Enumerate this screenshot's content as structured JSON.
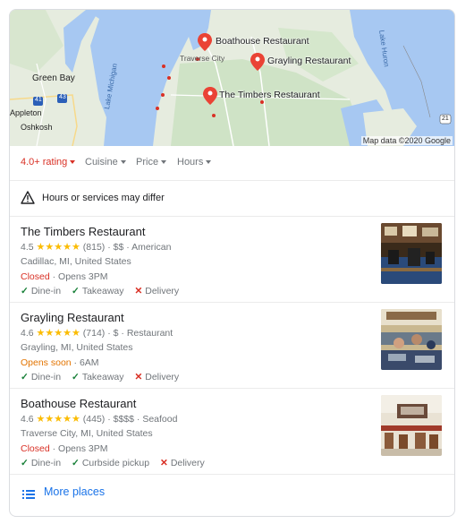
{
  "map": {
    "pins": [
      {
        "label": "Boathouse Restaurant"
      },
      {
        "label": "Grayling Restaurant"
      },
      {
        "label": "The Timbers Restaurant"
      }
    ],
    "place_labels": [
      "Green Bay",
      "Appleton",
      "Oshkosh",
      "Traverse City",
      "Lake Michigan",
      "Lake Huron"
    ],
    "road_labels": [
      "41",
      "43",
      "21"
    ],
    "credit": "Map data ©2020 Google"
  },
  "filters": [
    {
      "label": "4.0+ rating",
      "active": true
    },
    {
      "label": "Cuisine",
      "active": false
    },
    {
      "label": "Price",
      "active": false
    },
    {
      "label": "Hours",
      "active": false
    }
  ],
  "notice": "Hours or services may differ",
  "results": [
    {
      "title": "The Timbers Restaurant",
      "rating": "4.5",
      "stars": "★★★★★",
      "reviews": "(815)",
      "price": "$$",
      "category": "American",
      "address": "Cadillac, MI, United States",
      "status": "Closed",
      "status_color": "#d93025",
      "status_detail": "Opens 3PM",
      "services": [
        {
          "label": "Dine-in",
          "available": true
        },
        {
          "label": "Takeaway",
          "available": true
        },
        {
          "label": "Delivery",
          "available": false
        }
      ]
    },
    {
      "title": "Grayling Restaurant",
      "rating": "4.6",
      "stars": "★★★★★",
      "reviews": "(714)",
      "price": "$",
      "category": "Restaurant",
      "address": "Grayling, MI, United States",
      "status": "Opens soon",
      "status_color": "#e37400",
      "status_detail": "6AM",
      "services": [
        {
          "label": "Dine-in",
          "available": true
        },
        {
          "label": "Takeaway",
          "available": true
        },
        {
          "label": "Delivery",
          "available": false
        }
      ]
    },
    {
      "title": "Boathouse Restaurant",
      "rating": "4.6",
      "stars": "★★★★★",
      "reviews": "(445)",
      "price": "$$$$",
      "category": "Seafood",
      "address": "Traverse City, MI, United States",
      "status": "Closed",
      "status_color": "#d93025",
      "status_detail": "Opens 3PM",
      "services": [
        {
          "label": "Dine-in",
          "available": true
        },
        {
          "label": "Curbside pickup",
          "available": true
        },
        {
          "label": "Delivery",
          "available": false
        }
      ]
    }
  ],
  "more_places": "More places",
  "colors": {
    "accent": "#1a73e8",
    "red": "#d93025",
    "orange": "#e37400",
    "green": "#188038",
    "star": "#fbbc04"
  }
}
